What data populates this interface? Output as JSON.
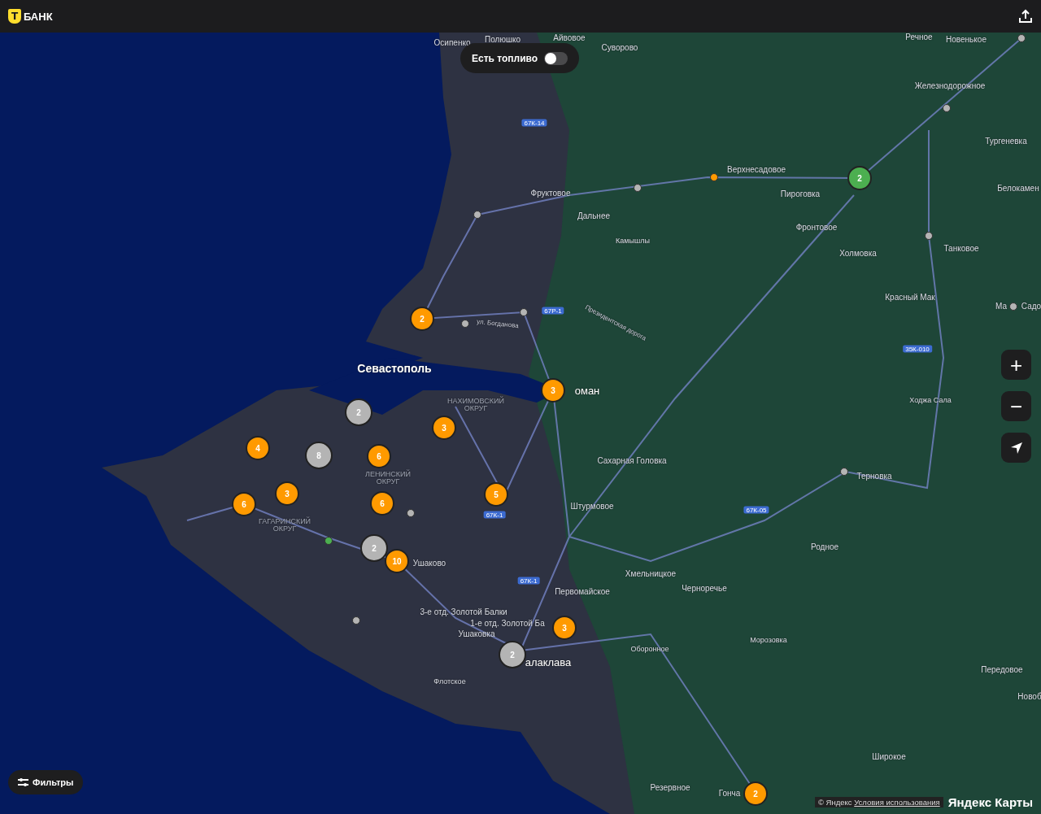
{
  "header": {
    "logo_letter": "Т",
    "logo_text": "БАНК"
  },
  "fuel_toggle": {
    "label": "Есть топливо",
    "on": false
  },
  "places": [
    {
      "label": "Осипенко",
      "kind": "village"
    },
    {
      "label": "Полюшко",
      "kind": "village"
    },
    {
      "label": "Айвовое",
      "kind": "village"
    },
    {
      "label": "Суворово",
      "kind": "village"
    },
    {
      "label": "Речное",
      "kind": "village"
    },
    {
      "label": "Новенькое",
      "kind": "village"
    },
    {
      "label": "Железнодорожное",
      "kind": "village"
    },
    {
      "label": "Тургеневка",
      "kind": "village"
    },
    {
      "label": "Верхнесадовое",
      "kind": "village"
    },
    {
      "label": "Фруктовое",
      "kind": "village"
    },
    {
      "label": "Пироговка",
      "kind": "village"
    },
    {
      "label": "Белокамен",
      "kind": "village"
    },
    {
      "label": "Дальнее",
      "kind": "village"
    },
    {
      "label": "Камышлы",
      "kind": "small"
    },
    {
      "label": "Фронтовое",
      "kind": "village"
    },
    {
      "label": "Танковое",
      "kind": "village"
    },
    {
      "label": "Холмовка",
      "kind": "village"
    },
    {
      "label": "Красный Мак",
      "kind": "village"
    },
    {
      "label": "Ма",
      "kind": "village"
    },
    {
      "label": "Садо",
      "kind": "village"
    },
    {
      "label": "Севастополь",
      "kind": "city"
    },
    {
      "label": "оман",
      "kind": "town"
    },
    {
      "label": "НАХИМОВСКИЙ ОКРУГ",
      "kind": "district"
    },
    {
      "label": "ЛЕНИНСКИЙ ОКРУГ",
      "kind": "district"
    },
    {
      "label": "ГАГАРИНСКИЙ ОКРУГ",
      "kind": "district"
    },
    {
      "label": "Ходжа Сала",
      "kind": "small"
    },
    {
      "label": "Сахарная Головка",
      "kind": "village"
    },
    {
      "label": "Штурмовое",
      "kind": "village"
    },
    {
      "label": "Терновка",
      "kind": "village"
    },
    {
      "label": "Родное",
      "kind": "village"
    },
    {
      "label": "Хмельницкое",
      "kind": "village"
    },
    {
      "label": "Черноречье",
      "kind": "village"
    },
    {
      "label": "Первомайское",
      "kind": "village"
    },
    {
      "label": "Ушаково",
      "kind": "village"
    },
    {
      "label": "3-е отд. Золотой Балки",
      "kind": "village"
    },
    {
      "label": "1-е отд. Золотой Ба",
      "kind": "village"
    },
    {
      "label": "Ушаковка",
      "kind": "village"
    },
    {
      "label": "Оборонное",
      "kind": "small"
    },
    {
      "label": "Морозовка",
      "kind": "small"
    },
    {
      "label": "алаклава",
      "kind": "town"
    },
    {
      "label": "Флотское",
      "kind": "small"
    },
    {
      "label": "Передовое",
      "kind": "village"
    },
    {
      "label": "Новоб",
      "kind": "village"
    },
    {
      "label": "Широкое",
      "kind": "village"
    },
    {
      "label": "Резервное",
      "kind": "village"
    },
    {
      "label": "Гонча",
      "kind": "village"
    },
    {
      "label": "Президентская дорога",
      "kind": "street"
    },
    {
      "label": "ул. Богданова",
      "kind": "street"
    }
  ],
  "road_shields": [
    {
      "label": "67К-14"
    },
    {
      "label": "67Р-1"
    },
    {
      "label": "67К-1"
    },
    {
      "label": "67К-1"
    },
    {
      "label": "35К-010"
    },
    {
      "label": "67К-05"
    }
  ],
  "clusters": [
    {
      "count": "2",
      "color": "#ff9a00"
    },
    {
      "count": "2",
      "color": "#b4b4b4"
    },
    {
      "count": "4",
      "color": "#ff9a00"
    },
    {
      "count": "8",
      "color": "#b4b4b4"
    },
    {
      "count": "6",
      "color": "#ff9a00"
    },
    {
      "count": "3",
      "color": "#ff9a00"
    },
    {
      "count": "3",
      "color": "#ff9a00"
    },
    {
      "count": "6",
      "color": "#ff9a00"
    },
    {
      "count": "3",
      "color": "#ff9a00"
    },
    {
      "count": "6",
      "color": "#ff9a00"
    },
    {
      "count": "5",
      "color": "#ff9a00"
    },
    {
      "count": "2",
      "color": "#b4b4b4"
    },
    {
      "count": "10",
      "color": "#ff9a00"
    },
    {
      "count": "3",
      "color": "#ff9a00"
    },
    {
      "count": "2",
      "color": "#b4b4b4"
    },
    {
      "count": "2",
      "color": "#4caf50"
    },
    {
      "count": "2",
      "color": "#ff9a00"
    }
  ],
  "stations": [
    {
      "color": "#b4b4b4"
    },
    {
      "color": "#b4b4b4"
    },
    {
      "color": "#ff9a00"
    },
    {
      "color": "#b4b4b4"
    },
    {
      "color": "#b4b4b4"
    },
    {
      "color": "#b4b4b4"
    },
    {
      "color": "#b4b4b4"
    },
    {
      "color": "#b4b4b4"
    },
    {
      "color": "#b4b4b4"
    },
    {
      "color": "#b4b4b4"
    },
    {
      "color": "#b4b4b4"
    },
    {
      "color": "#b4b4b4"
    },
    {
      "color": "#4caf50"
    }
  ],
  "zoom_controls": {
    "zoom_in": "+",
    "zoom_out": "−"
  },
  "filters_button": {
    "label": "Фильтры"
  },
  "attribution": {
    "copyright": "© Яндекс",
    "terms_link": "Условия использования",
    "brand": "Яндекс Карты"
  }
}
